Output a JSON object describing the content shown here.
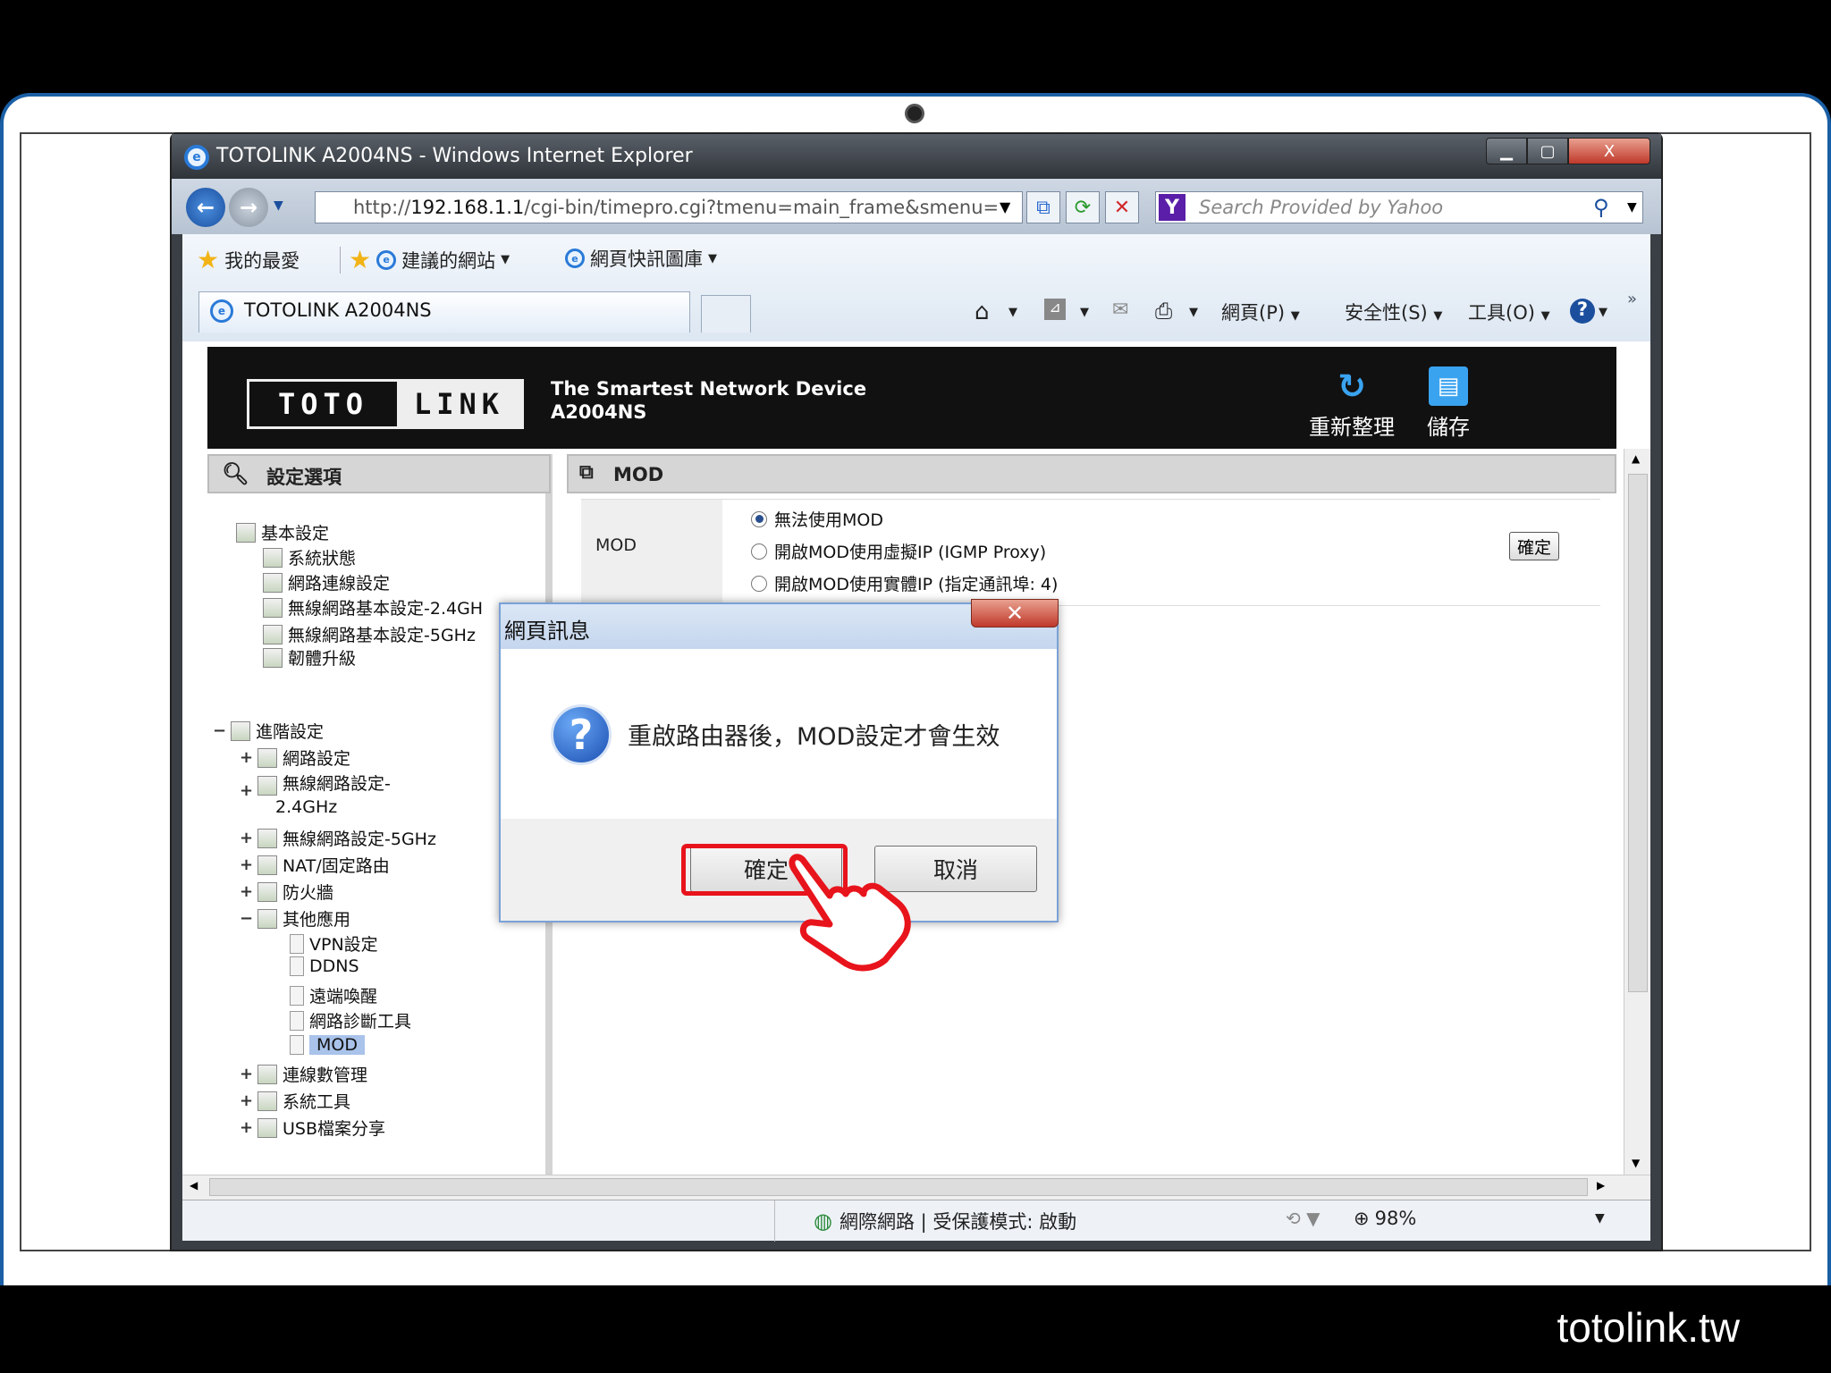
{
  "window": {
    "title": "TOTOLINK A2004NS - Windows Internet Explorer",
    "minimize_icon": "minimize-icon",
    "maximize_icon": "maximize-icon",
    "close_glyph": "X"
  },
  "address": {
    "url_prefix": "http://",
    "url_host": "192.168.1.1",
    "url_path": "/cgi-bin/timepro.cgi?tmenu=main_frame&smenu=",
    "search_placeholder": "Search Provided by Yahoo"
  },
  "favorites": {
    "label": "我的最愛",
    "suggested_sites": "建議的網站",
    "web_slice_gallery": "網頁快訊圖庫"
  },
  "tabs": [
    {
      "label": "TOTOLINK A2004NS"
    }
  ],
  "commandbar": {
    "page": "網頁(P)",
    "safety": "安全性(S)",
    "tools": "工具(O)",
    "more": "»"
  },
  "router": {
    "slogan_line1": "The Smartest Network Device",
    "slogan_line2": "A2004NS",
    "logo_left": "TOTO",
    "logo_right": "LINK",
    "refresh_label": "重新整理",
    "save_label": "儲存"
  },
  "sidebar": {
    "title": "設定選項",
    "basic": {
      "label": "基本設定",
      "items": [
        "系統狀態",
        "網路連線設定",
        "無線網路基本設定-2.4GH",
        "無線網路基本設定-5GHz",
        "韌體升級"
      ]
    },
    "advanced": {
      "label": "進階設定",
      "items": [
        "網路設定",
        "無線網路設定-",
        "2.4GHz",
        "無線網路設定-5GHz",
        "NAT/固定路由",
        "防火牆",
        "其他應用"
      ],
      "other_children": [
        "VPN設定",
        "DDNS",
        "遠端喚醒",
        "網路診斷工具",
        "MOD"
      ],
      "after": [
        "連線數管理",
        "系統工具",
        "USB檔案分享"
      ]
    }
  },
  "main": {
    "section_title": "MOD",
    "row_label": "MOD",
    "options": [
      "無法使用MOD",
      "開啟MOD使用虛擬IP (IGMP Proxy)",
      "開啟MOD使用實體IP (指定通訊埠: 4)"
    ],
    "selected_option": "無法使用MOD",
    "confirm_label": "確定"
  },
  "dialog": {
    "title": "網頁訊息",
    "message": "重啟路由器後，MOD設定才會生效",
    "ok_label": "確定",
    "cancel_label": "取消"
  },
  "statusbar": {
    "zone": "網際網路 | 受保護模式: 啟動",
    "zoom": "98%"
  },
  "watermark": "totolink.tw",
  "colors": {
    "highlight": "#e8141c",
    "selection": "#a9c3ea"
  }
}
